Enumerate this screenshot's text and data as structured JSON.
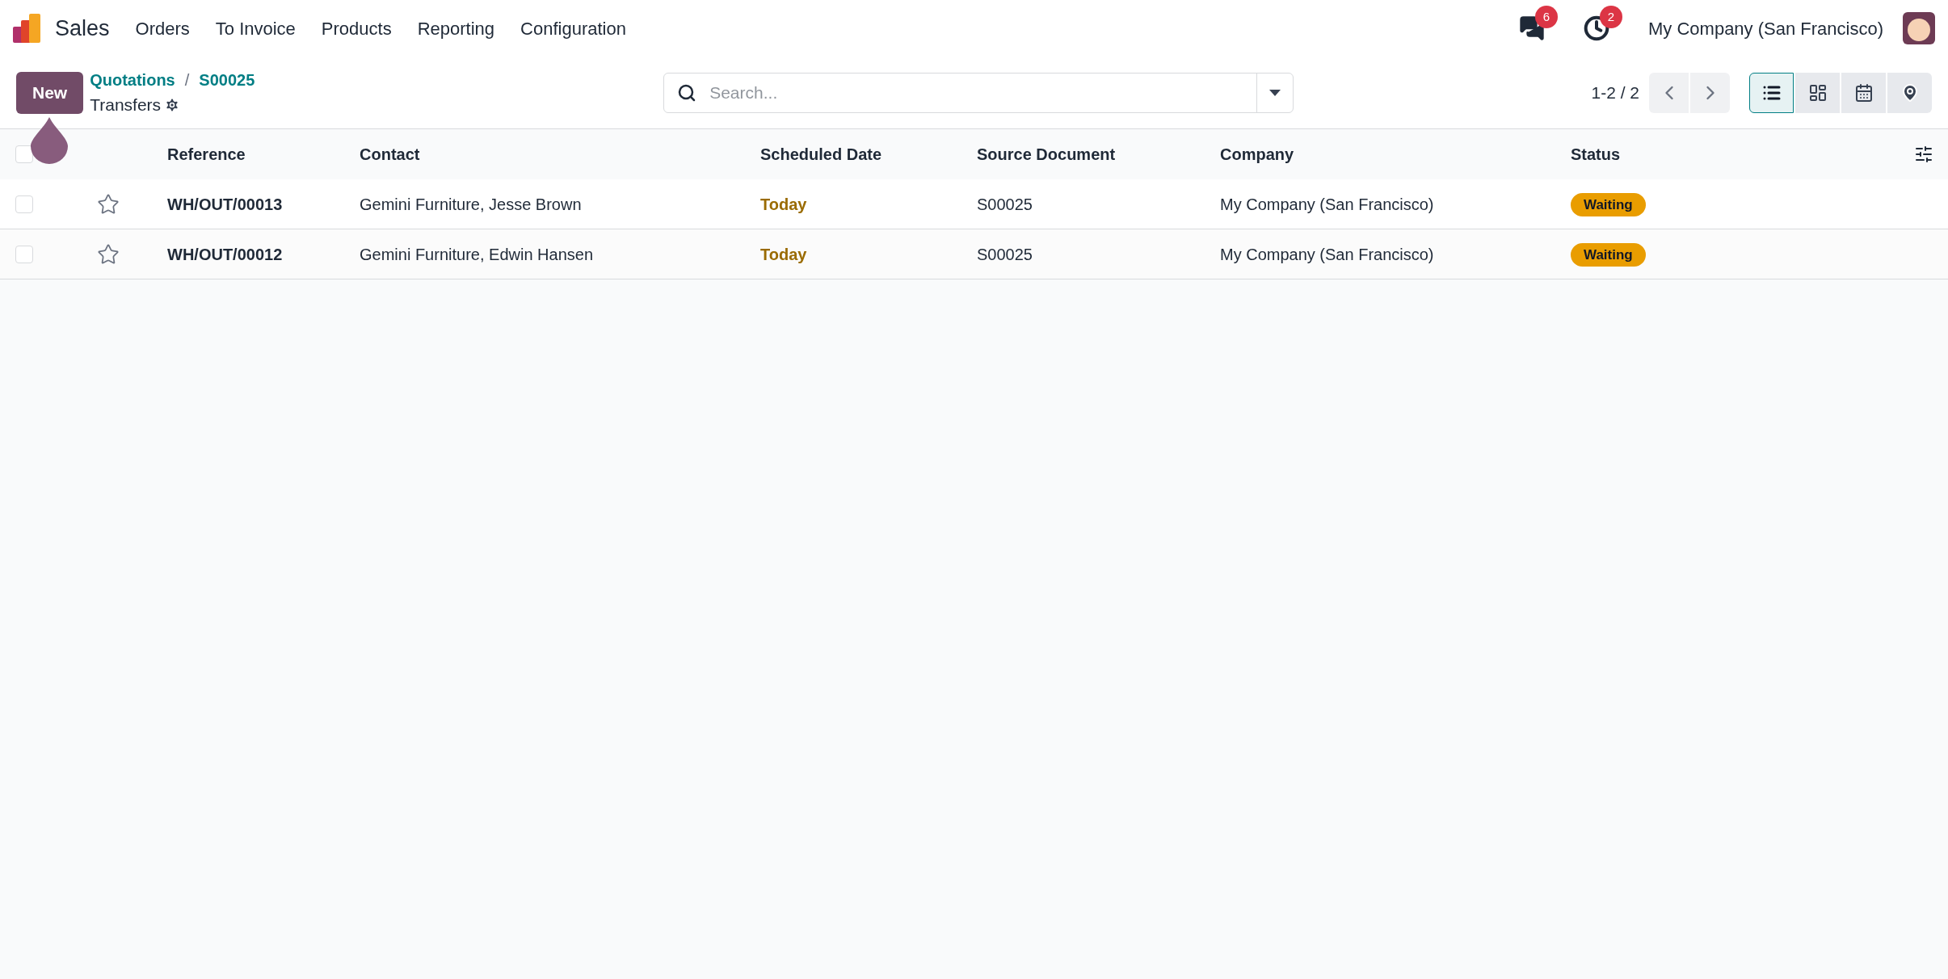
{
  "navbar": {
    "app_name": "Sales",
    "menu": [
      "Orders",
      "To Invoice",
      "Products",
      "Reporting",
      "Configuration"
    ],
    "messages_count": "6",
    "activities_count": "2",
    "company": "My Company (San Francisco)"
  },
  "control_panel": {
    "new_button": "New",
    "breadcrumbs": [
      "Quotations",
      "S00025"
    ],
    "breadcrumb_separator": "/",
    "title": "Transfers",
    "search": {
      "placeholder": "Search..."
    },
    "pager": "1-2 / 2",
    "views": [
      {
        "kind": "list",
        "selected": true
      },
      {
        "kind": "kanban",
        "selected": false
      },
      {
        "kind": "calendar",
        "selected": false
      },
      {
        "kind": "map",
        "selected": false
      }
    ]
  },
  "table": {
    "select_all_checked": false,
    "columns": [
      "Reference",
      "Contact",
      "Scheduled Date",
      "Source Document",
      "Company",
      "Status"
    ],
    "rows": [
      {
        "checked": false,
        "starred": false,
        "reference": "WH/OUT/00013",
        "contact": "Gemini Furniture, Jesse Brown",
        "scheduled_date": "Today",
        "source_document": "S00025",
        "company": "My Company (San Francisco)",
        "status": "Waiting"
      },
      {
        "checked": false,
        "starred": false,
        "reference": "WH/OUT/00012",
        "contact": "Gemini Furniture, Edwin Hansen",
        "scheduled_date": "Today",
        "source_document": "S00025",
        "company": "My Company (San Francisco)",
        "status": "Waiting"
      }
    ]
  }
}
